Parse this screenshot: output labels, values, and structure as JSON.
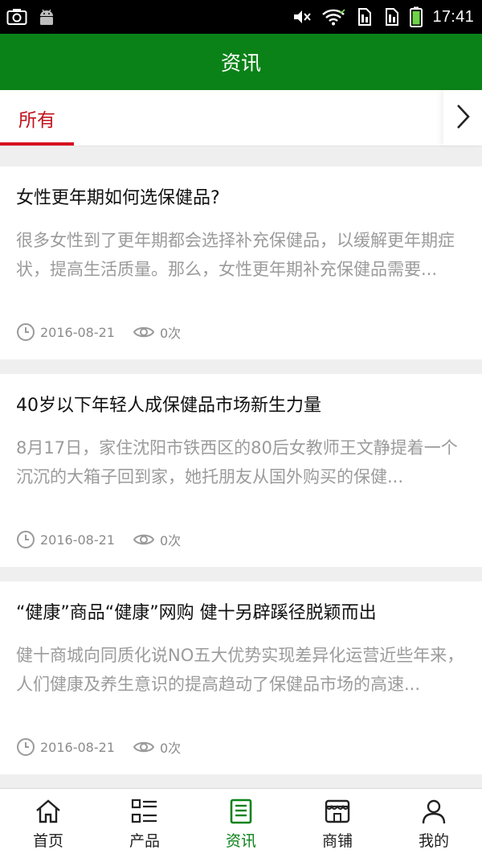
{
  "status_bar": {
    "time": "17:41"
  },
  "header": {
    "title": "资讯"
  },
  "tabs": {
    "active_label": "所有"
  },
  "news": [
    {
      "title": "女性更年期如何选保健品?",
      "summary": "很多女性到了更年期都会选择补充保健品，以缓解更年期症状，提高生活质量。那么，女性更年期补充保健品需要...",
      "date": "2016-08-21",
      "views": "0次"
    },
    {
      "title": "40岁以下年轻人成保健品市场新生力量",
      "summary": "8月17日，家住沈阳市铁西区的80后女教师王文静提着一个沉沉的大箱子回到家，她托朋友从国外购买的保健...",
      "date": "2016-08-21",
      "views": "0次"
    },
    {
      "title": "“健康”商品“健康”网购 健十另辟蹊径脱颖而出",
      "summary": "健十商城向同质化说NO五大优势实现差异化运营近些年来，人们健康及养生意识的提高趋动了保健品市场的高速...",
      "date": "2016-08-21",
      "views": "0次"
    }
  ],
  "bottom_nav": {
    "items": [
      {
        "label": "首页",
        "icon": "home-icon"
      },
      {
        "label": "产品",
        "icon": "grid-list-icon"
      },
      {
        "label": "资讯",
        "icon": "document-icon"
      },
      {
        "label": "商铺",
        "icon": "store-icon"
      },
      {
        "label": "我的",
        "icon": "user-icon"
      }
    ],
    "active_index": 2
  },
  "colors": {
    "brand": "#0b8218",
    "tab_active": "#d71220",
    "summary_text": "#9b9b9b"
  }
}
